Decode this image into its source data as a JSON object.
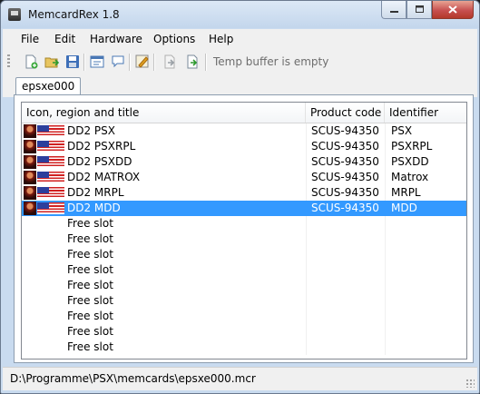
{
  "window": {
    "title": "MemcardRex 1.8"
  },
  "menu": [
    {
      "label": "File",
      "name": "menu-file"
    },
    {
      "label": "Edit",
      "name": "menu-edit"
    },
    {
      "label": "Hardware",
      "name": "menu-hardware"
    },
    {
      "label": "Options",
      "name": "menu-options"
    },
    {
      "label": "Help",
      "name": "menu-help"
    }
  ],
  "toolbar": {
    "buttons": [
      "new-file-icon",
      "open-file-icon",
      "save-icon",
      "edit-header-icon",
      "edit-comment-icon",
      "edit-icon-icon",
      "temp-buffer-copy-icon",
      "temp-buffer-paste-icon"
    ],
    "status": "Temp buffer is empty"
  },
  "tabs": [
    {
      "label": "epsxe000"
    }
  ],
  "list": {
    "columns": [
      "Icon, region and title",
      "Product code",
      "Identifier"
    ],
    "saves": [
      {
        "title": "DD2  PSX",
        "product_code": "SCUS-94350",
        "identifier": "PSX"
      },
      {
        "title": "DD2  PSXRPL",
        "product_code": "SCUS-94350",
        "identifier": "PSXRPL"
      },
      {
        "title": "DD2  PSXDD",
        "product_code": "SCUS-94350",
        "identifier": "PSXDD"
      },
      {
        "title": "DD2  MATROX",
        "product_code": "SCUS-94350",
        "identifier": "Matrox"
      },
      {
        "title": "DD2  MRPL",
        "product_code": "SCUS-94350",
        "identifier": "MRPL"
      },
      {
        "title": "DD2  MDD",
        "product_code": "SCUS-94350",
        "identifier": "MDD"
      }
    ],
    "selected_index": 5,
    "free_slots": [
      "Free slot",
      "Free slot",
      "Free slot",
      "Free slot",
      "Free slot",
      "Free slot",
      "Free slot",
      "Free slot",
      "Free slot"
    ],
    "region_icon": "us-flag-icon"
  },
  "statusbar": {
    "path": "D:\\Programme\\PSX\\memcards\\epsxe000.mcr"
  },
  "colors": {
    "selection": "#3399ff",
    "titlebar": "#c9dbef",
    "close": "#c75050"
  }
}
